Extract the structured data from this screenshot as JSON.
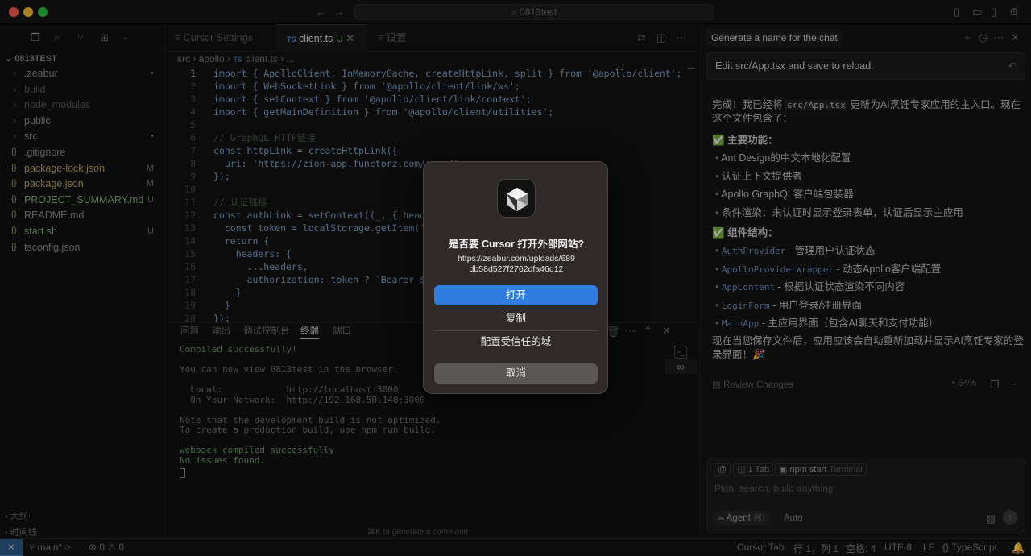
{
  "window": {
    "search_text": "0813test"
  },
  "sidebar": {
    "root": "0813TEST",
    "items": [
      {
        "name": ".zeabur",
        "status": "•",
        "kind": "folder"
      },
      {
        "name": "build",
        "status": "",
        "kind": "folder"
      },
      {
        "name": "node_modules",
        "status": "",
        "kind": "folder"
      },
      {
        "name": "public",
        "status": "",
        "kind": "folder"
      },
      {
        "name": "src",
        "status": "•",
        "kind": "folder"
      },
      {
        "name": ".gitignore",
        "status": "",
        "kind": "file"
      },
      {
        "name": "package-lock.json",
        "status": "M",
        "kind": "file"
      },
      {
        "name": "package.json",
        "status": "M",
        "kind": "file"
      },
      {
        "name": "PROJECT_SUMMARY.md",
        "status": "U",
        "kind": "file"
      },
      {
        "name": "README.md",
        "status": "",
        "kind": "file"
      },
      {
        "name": "start.sh",
        "status": "U",
        "kind": "file"
      },
      {
        "name": "tsconfig.json",
        "status": "",
        "kind": "file"
      }
    ],
    "outline": "大纲",
    "timeline": "时间线"
  },
  "editor": {
    "tabs": [
      {
        "label": "Cursor Settings"
      },
      {
        "label": "client.ts",
        "badge": "TS",
        "status": "U"
      },
      {
        "label": "设置"
      }
    ],
    "breadcrumb": [
      "src",
      "apollo",
      "client.ts",
      "..."
    ],
    "lines": [
      {
        "n": "1",
        "code": "import { ApolloClient, InMemoryCache, createHttpLink, split } from '@apollo/client';"
      },
      {
        "n": "2",
        "code": "import { WebSocketLink } from '@apollo/client/link/ws';"
      },
      {
        "n": "3",
        "code": "import { setContext } from '@apollo/client/link/context';"
      },
      {
        "n": "4",
        "code": "import { getMainDefinition } from '@apollo/client/utilities';"
      },
      {
        "n": "5",
        "code": ""
      },
      {
        "n": "6",
        "code": "// GraphQL HTTP链接"
      },
      {
        "n": "7",
        "code": "const httpLink = createHttpLink({"
      },
      {
        "n": "8",
        "code": "  uri: 'https://zion-app.functorz.com/zero/'"
      },
      {
        "n": "9",
        "code": "});"
      },
      {
        "n": "10",
        "code": ""
      },
      {
        "n": "11",
        "code": "// 认证链接"
      },
      {
        "n": "12",
        "code": "const authLink = setContext((_, { headers"
      },
      {
        "n": "13",
        "code": "  const token = localStorage.getItem('aut"
      },
      {
        "n": "14",
        "code": "  return {"
      },
      {
        "n": "15",
        "code": "    headers: {"
      },
      {
        "n": "16",
        "code": "      ...headers,"
      },
      {
        "n": "17",
        "code": "      authorization: token ? `Bearer ${to"
      },
      {
        "n": "18",
        "code": "    }"
      },
      {
        "n": "19",
        "code": "  }"
      },
      {
        "n": "20",
        "code": "});"
      }
    ]
  },
  "panel": {
    "tabs": [
      "问题",
      "输出",
      "调试控制台",
      "终端",
      "端口"
    ],
    "terminal": [
      "Compiled successfully!",
      "",
      "You can now view 0813test in the browser.",
      "",
      "  Local:            http://localhost:3000",
      "  On Your Network:  http://192.168.50.148:3000",
      "",
      "Note that the development build is not optimized.",
      "To create a production build, use npm run build.",
      "",
      "webpack compiled successfully",
      "No issues found."
    ],
    "hint": "⌘K to generate a command"
  },
  "chat": {
    "title": "Generate a name for the chat",
    "prompt": "Edit src/App.tsx and save to reload.",
    "intro_pre": "完成！我已经将 ",
    "intro_code": "src/App.tsx",
    "intro_post": " 更新为AI烹饪专家应用的主入口。现在这个文件包含了：",
    "section1": "主要功能：",
    "features": [
      "Ant Design的中文本地化配置",
      "认证上下文提供者",
      "Apollo GraphQL客户端包装器",
      "条件渲染：未认证时显示登录表单，认证后显示主应用"
    ],
    "section2": "组件结构：",
    "components": [
      {
        "code": "AuthProvider",
        "text": " - 管理用户认证状态"
      },
      {
        "code": "ApolloProviderWrapper",
        "text": " - 动态Apollo客户端配置"
      },
      {
        "code": "AppContent",
        "text": " - 根据认证状态渲染不同内容"
      },
      {
        "code": "LoginForm",
        "text": " - 用户登录/注册界面"
      },
      {
        "code": "MainApp",
        "text": " - 主应用界面（包含AI聊天和支付功能）"
      }
    ],
    "outro": "现在当您保存文件后，应用应该会自动重新加载并显示AI烹饪专家的登录界面！🎉",
    "review": "Review Changes",
    "progress": "64%",
    "chips": [
      "@",
      "1 Tab",
      "npm start"
    ],
    "chip_terminal": "Terminal",
    "input_placeholder": "Plan, search, build anything",
    "agent": "Agent",
    "agent_kbd": "⌘I",
    "model": "Auto"
  },
  "statusbar": {
    "branch": "main*",
    "errors": "0",
    "warnings": "0",
    "cursor_tab": "Cursor Tab",
    "position": "行 1，列 1",
    "spaces": "空格: 4",
    "encoding": "UTF-8",
    "eol": "LF",
    "language": "TypeScript"
  },
  "dialog": {
    "title": "是否要 Cursor 打开外部网站?",
    "url": "https://zeabur.com/uploads/689db58d527f2762dfa46d12",
    "open": "打开",
    "copy": "复制",
    "configure": "配置受信任的域",
    "cancel": "取消"
  },
  "colors": {
    "accent": "#2f7de1",
    "modified": "#b7a25a",
    "untracked": "#6ea36a"
  }
}
